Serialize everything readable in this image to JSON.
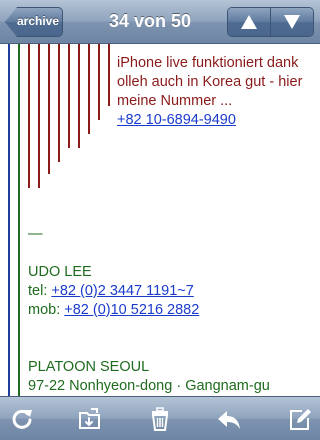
{
  "navbar": {
    "back_label": "archive",
    "title": "34 von 50",
    "prev_icon": "arrow-up-icon",
    "next_icon": "arrow-down-icon"
  },
  "message": {
    "quote_lines": [
      "iPhone live funktioniert dank",
      "olleh auch in Korea gut - hier",
      "meine Nummer ..."
    ],
    "quote_phone": "+82 10-6894-9490",
    "separator": "—",
    "signature": {
      "name": "UDO LEE",
      "tel_label": "tel: ",
      "tel_value": "+82 (0)2 3447 1191~7",
      "mob_label": "mob: ",
      "mob_value": "+82 (0)10 5216 2882",
      "company": "PLATOON SEOUL",
      "address": "97-22 Nonhyeon-dong · Gangnam-gu"
    }
  },
  "colors": {
    "quote": "#8b1a1a",
    "signature": "#1f6b1f",
    "link": "#1a3bcc",
    "line_blue": "#1f3f9a",
    "line_green": "#1f6b1f",
    "line_red": "#8b1a1a"
  },
  "toolbar": {
    "icons": [
      "refresh-icon",
      "move-to-folder-icon",
      "trash-icon",
      "reply-icon",
      "compose-icon"
    ]
  }
}
